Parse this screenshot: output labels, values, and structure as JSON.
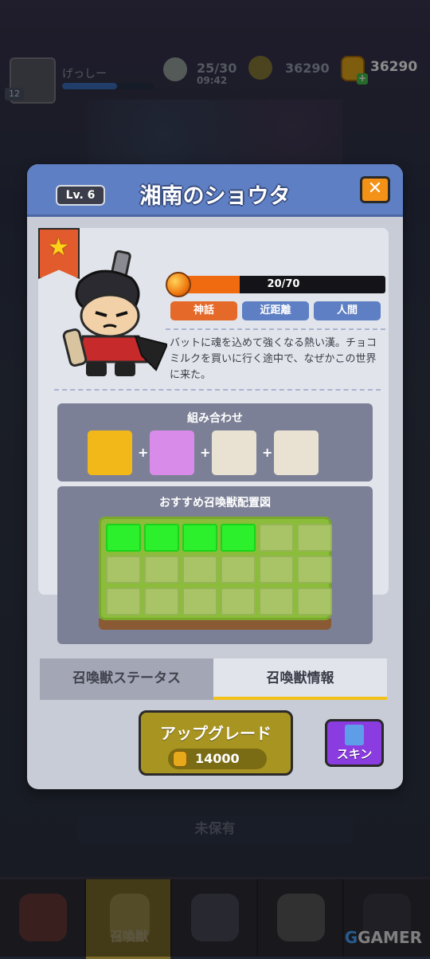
{
  "hud": {
    "player_name": "げっしー",
    "player_level": "12",
    "energy": "25/30",
    "energy_timer": "09:42",
    "honey": "36290",
    "coins": "36290"
  },
  "modal": {
    "level": "Lv. 6",
    "title": "湘南のショウタ",
    "close_icon": "✕",
    "exp": {
      "current": 20,
      "max": 70,
      "text": "20/70"
    },
    "tags": [
      "神話",
      "近距離",
      "人間"
    ],
    "description": "バットに魂を込めて強くなる熱い漢。チョコミルクを買いに行く途中で、なぜかこの世界に来た。",
    "combo": {
      "title": "組み合わせ",
      "items": [
        {
          "icon": "shiba-dog-icon",
          "color": "#f2b81a"
        },
        {
          "icon": "plant-creature-icon",
          "color": "#d88be8"
        },
        {
          "icon": "ninja-icon",
          "color": "#e9e2d2"
        },
        {
          "icon": "ninja-icon",
          "color": "#e9e2d2"
        }
      ],
      "plus": "+"
    },
    "layout": {
      "title": "おすすめ召喚獣配置図",
      "rows": 3,
      "cols": 6,
      "active_cells": [
        0,
        1,
        2,
        3
      ]
    },
    "tabs": {
      "status": "召喚獣ステータス",
      "info": "召喚獣情報"
    },
    "upgrade": {
      "label": "アップグレード",
      "cost": "14000"
    },
    "skin": {
      "label": "スキン"
    }
  },
  "background": {
    "not_owned": "未保有",
    "nav_active_label": "召喚獣"
  },
  "watermark": {
    "g": "G",
    "rest": "GAMER"
  },
  "colors": {
    "header_blue": "#5e7fc4",
    "accent_orange": "#f39216",
    "grid_active": "#2cf02c",
    "skin_purple": "#8b3ce0"
  }
}
